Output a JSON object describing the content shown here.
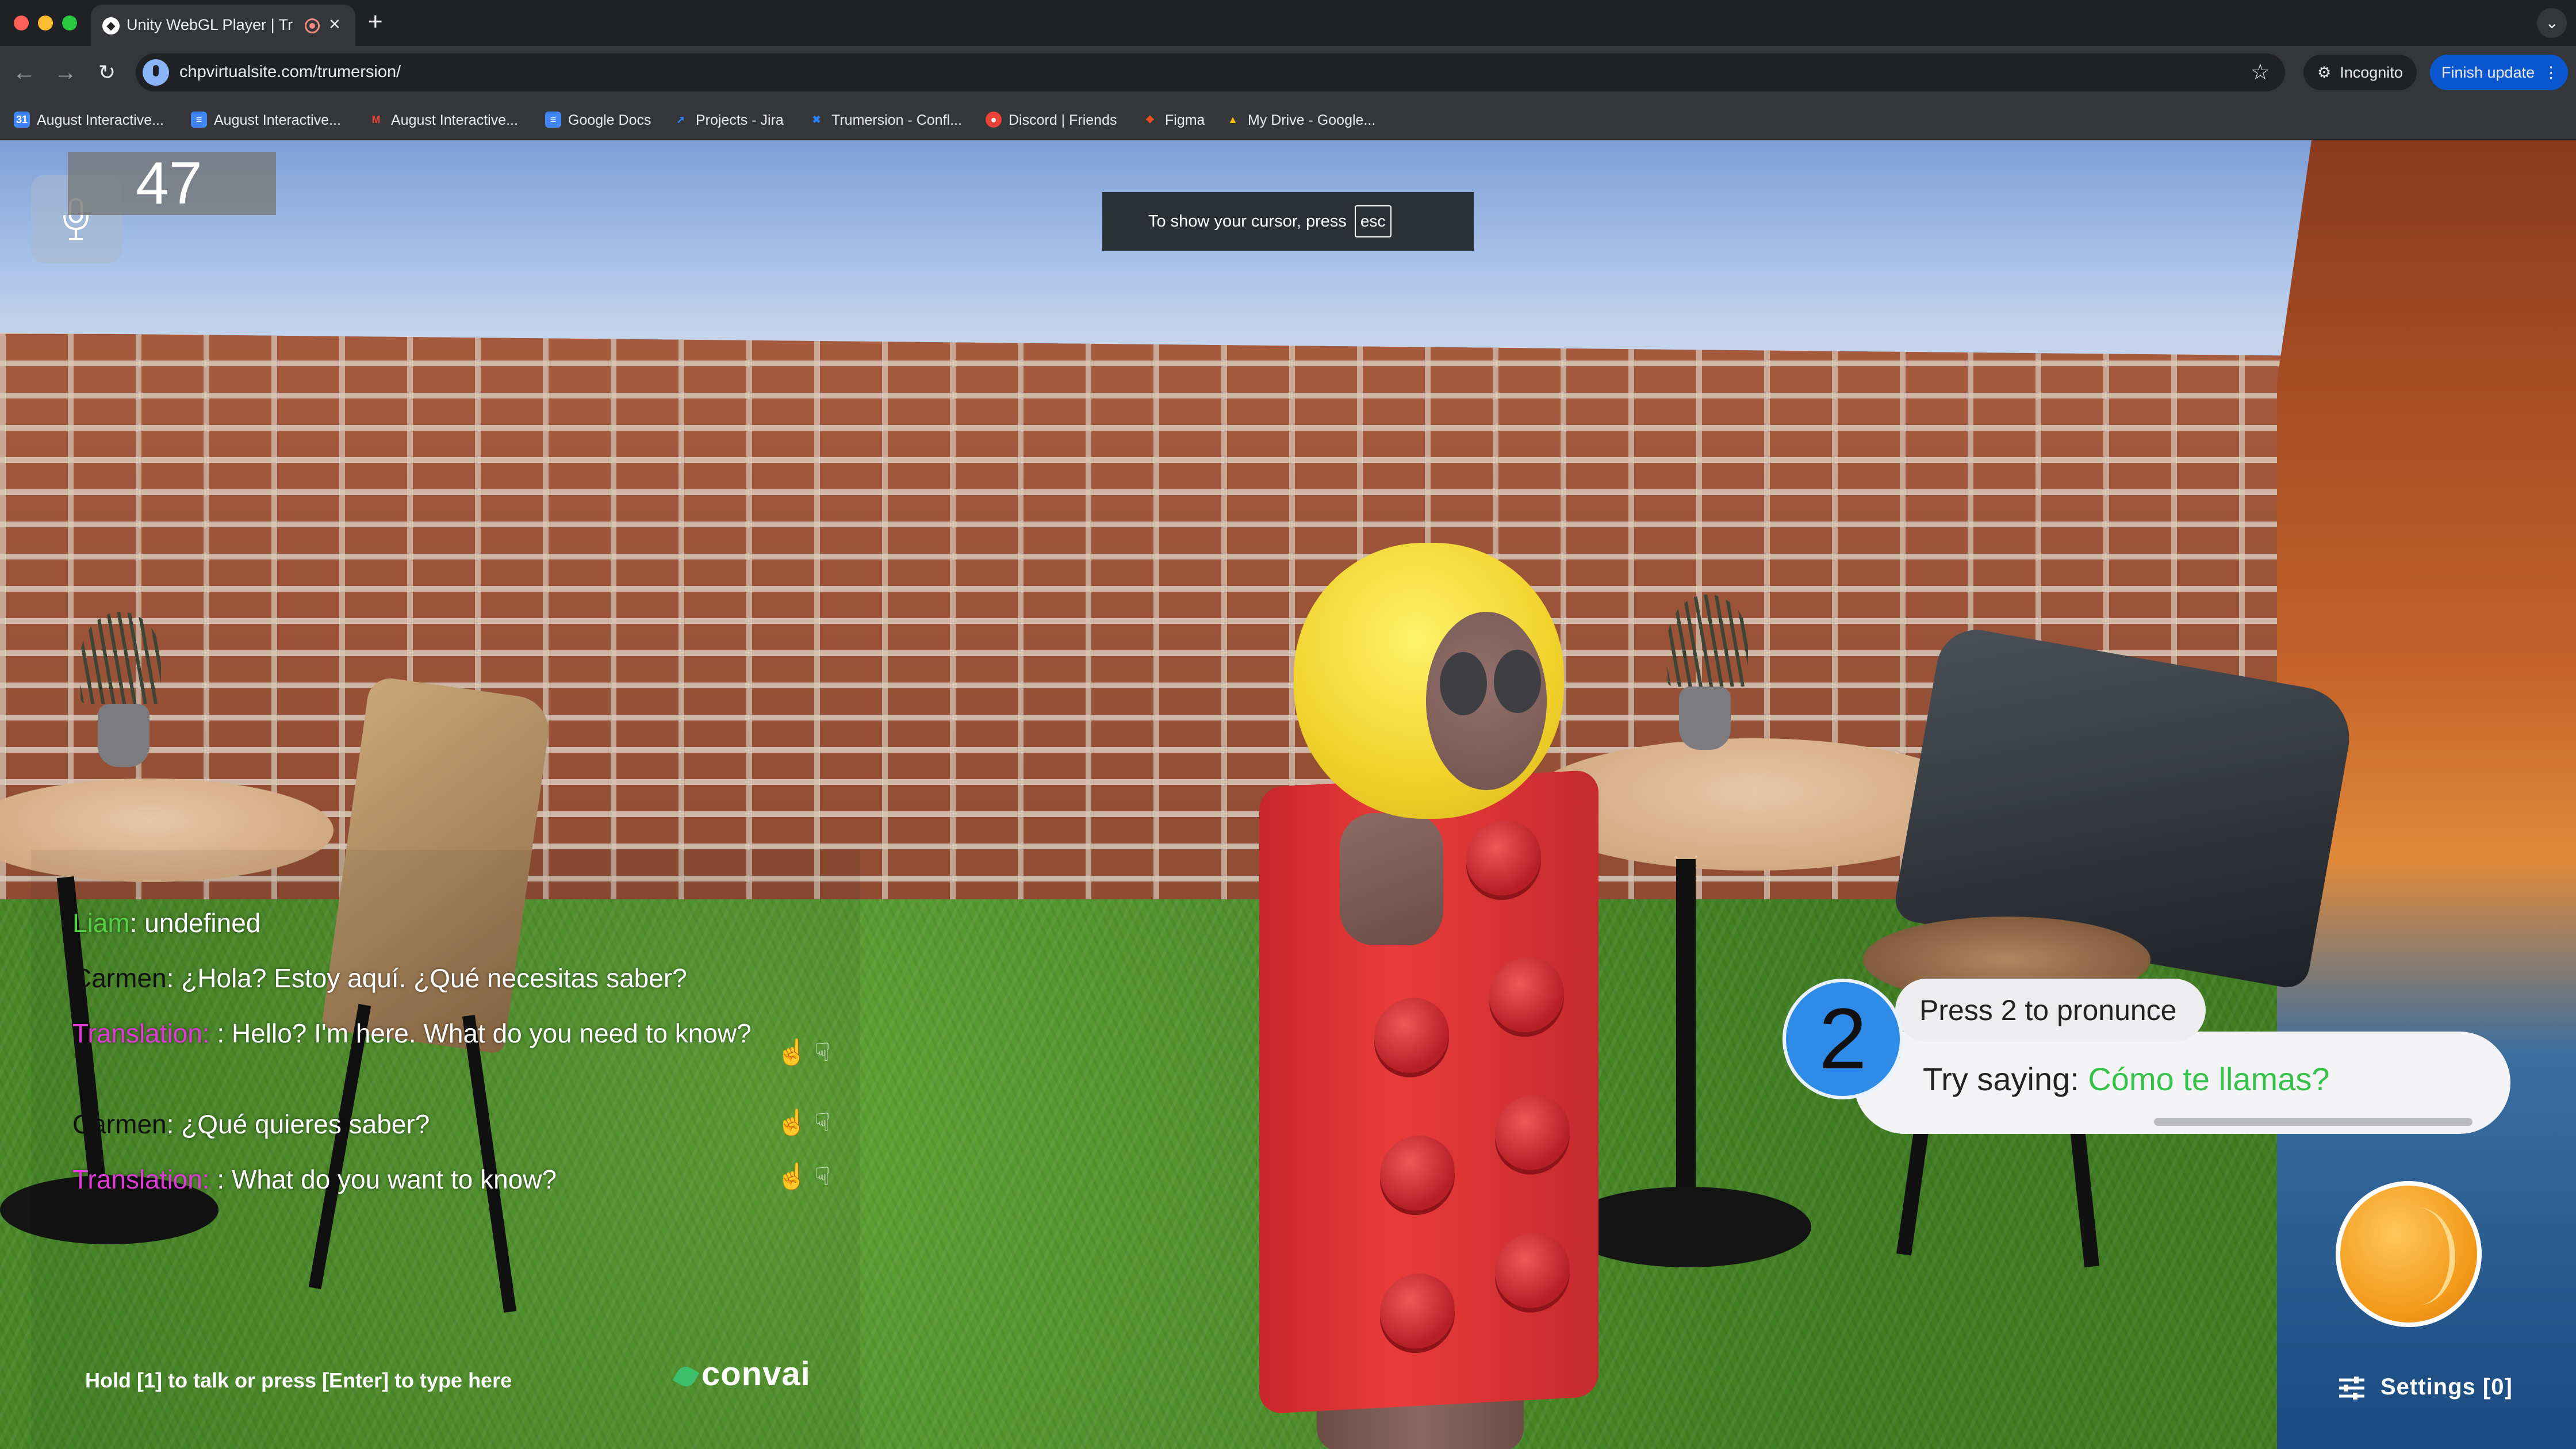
{
  "browser": {
    "tab_title": "Unity WebGL Player | Trur",
    "url": "chpvirtualsite.com/trumersion/",
    "incognito_label": "Incognito",
    "finish_update_label": "Finish update",
    "bookmarks": [
      {
        "label": "August Interactive...",
        "icon": "calendar-icon",
        "color": "#4285f4"
      },
      {
        "label": "August Interactive...",
        "icon": "doc-icon",
        "color": "#4285f4"
      },
      {
        "label": "August Interactive...",
        "icon": "gmail-icon",
        "color": "#ea4335"
      },
      {
        "label": "Google Docs",
        "icon": "doc-icon",
        "color": "#4285f4"
      },
      {
        "label": "Projects - Jira",
        "icon": "jira-icon",
        "color": "#2684ff"
      },
      {
        "label": "Trumersion - Confl...",
        "icon": "confluence-icon",
        "color": "#2684ff"
      },
      {
        "label": "Discord | Friends",
        "icon": "discord-icon",
        "color": "#ea4335"
      },
      {
        "label": "Figma",
        "icon": "figma-icon",
        "color": "#f24e1e"
      },
      {
        "label": "My Drive - Google...",
        "icon": "drive-icon",
        "color": "#fbbc04"
      }
    ]
  },
  "hud": {
    "counter": "47",
    "cursor_hint": "To show your cursor, press",
    "cursor_key": "esc",
    "hold_hint": "Hold [1] to talk or press [Enter] to type here",
    "brand": "convai",
    "settings_label": "Settings [0]"
  },
  "chat": [
    {
      "speaker": "Liam",
      "speaker_color": "#55d04a",
      "text": ": undefined",
      "feedback": false
    },
    {
      "speaker": "Carmen",
      "speaker_color": "#111111",
      "text": ": ¿Hola? Estoy aquí. ¿Qué necesitas saber?",
      "feedback": false
    },
    {
      "speaker": "Translation:",
      "speaker_color": "#e03ad6",
      "text": " : Hello? I'm here. What do you need to know?",
      "feedback": true
    },
    {
      "speaker": "Carmen",
      "speaker_color": "#111111",
      "text": ": ¿Qué quieres saber?",
      "feedback": true
    },
    {
      "speaker": "Translation:",
      "speaker_color": "#e03ad6",
      "text": " : What do you want to know?",
      "feedback": true
    }
  ],
  "pronounce": {
    "badge": "2",
    "press_label": "Press 2 to pronunce",
    "try_label": "Try saying: ",
    "phrase": "Cómo te llamas?"
  }
}
